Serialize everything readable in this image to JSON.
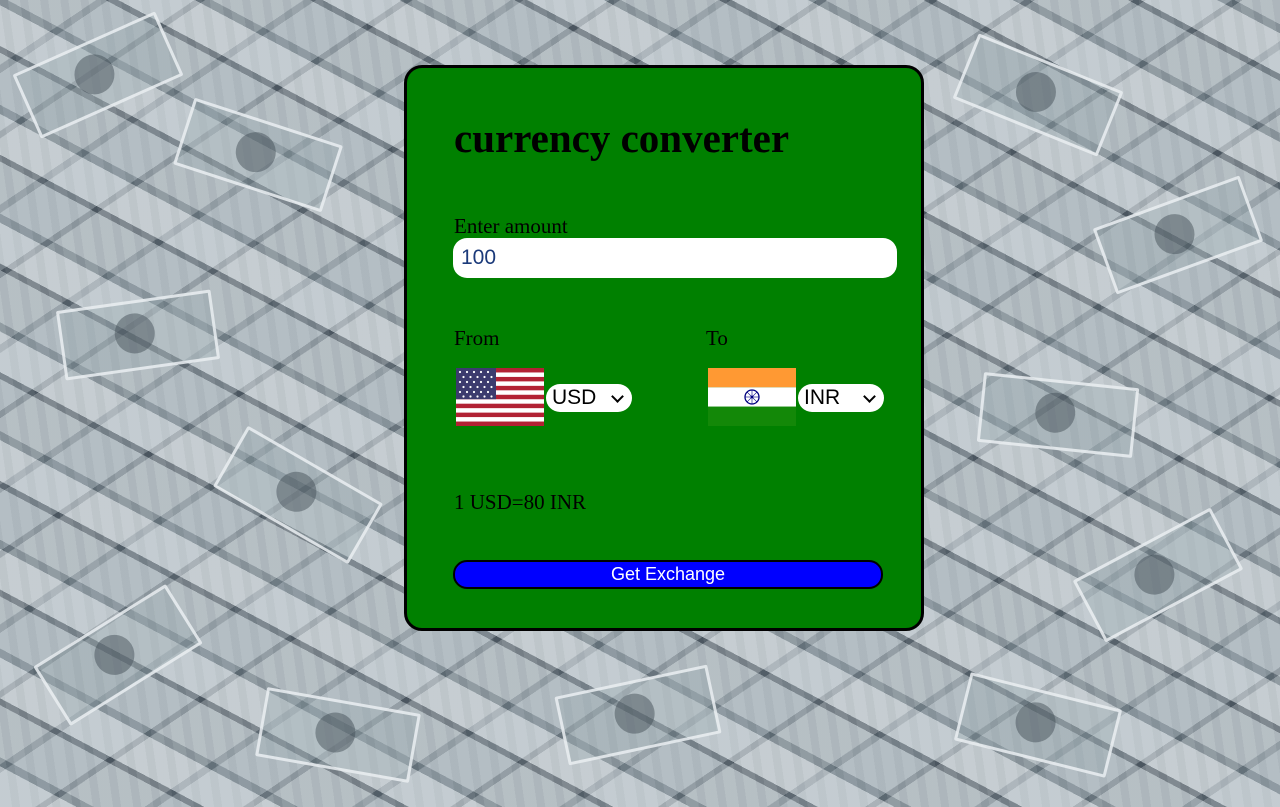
{
  "app": {
    "title": "currency converter"
  },
  "amount": {
    "label": "Enter amount",
    "value": "100"
  },
  "from": {
    "label": "From",
    "flag_icon": "us-flag-icon",
    "selected": "USD"
  },
  "to": {
    "label": "To",
    "flag_icon": "india-flag-icon",
    "selected": "INR"
  },
  "rate_text": "1 USD=80 INR",
  "button": {
    "label": "Get Exchange"
  },
  "colors": {
    "card_background": "#008000",
    "button_background": "#0000ff",
    "button_text": "#ffffff"
  }
}
